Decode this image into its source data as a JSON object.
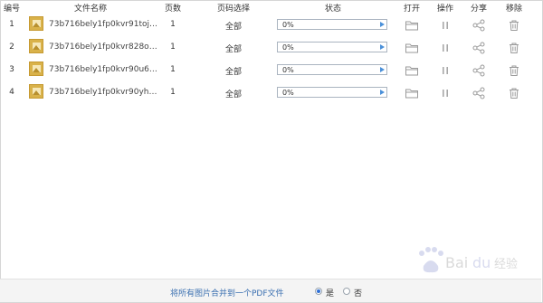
{
  "columns": {
    "num": "编号",
    "name": "文件名称",
    "pages": "页数",
    "range": "页码选择",
    "status": "状态",
    "open": "打开",
    "action": "操作",
    "share": "分享",
    "remove": "移除"
  },
  "rows": [
    {
      "num": "1",
      "name": "73b716bely1fp0kvr91toj2...",
      "pages": "1",
      "range": "全部",
      "progress_text": "0%",
      "progress": 0
    },
    {
      "num": "2",
      "name": "73b716bely1fp0kvr828oj...",
      "pages": "1",
      "range": "全部",
      "progress_text": "0%",
      "progress": 0
    },
    {
      "num": "3",
      "name": "73b716bely1fp0kvr90u6j...",
      "pages": "1",
      "range": "全部",
      "progress_text": "0%",
      "progress": 0
    },
    {
      "num": "4",
      "name": "73b716bely1fp0kvr90yhj...",
      "pages": "1",
      "range": "全部",
      "progress_text": "0%",
      "progress": 0
    }
  ],
  "bottom": {
    "merge_label": "将所有图片合并到一个PDF文件",
    "yes": "是",
    "no": "否",
    "selected": "yes"
  },
  "watermark": "Baidu经验",
  "colors": {
    "accent": "#4a90d9",
    "link": "#3a6fb0",
    "thumb": "#d9b24a",
    "icon": "#9a9a9a"
  },
  "icons": [
    "image-file-icon",
    "play-icon",
    "folder-icon",
    "pause-icon",
    "share-icon",
    "trash-icon"
  ]
}
